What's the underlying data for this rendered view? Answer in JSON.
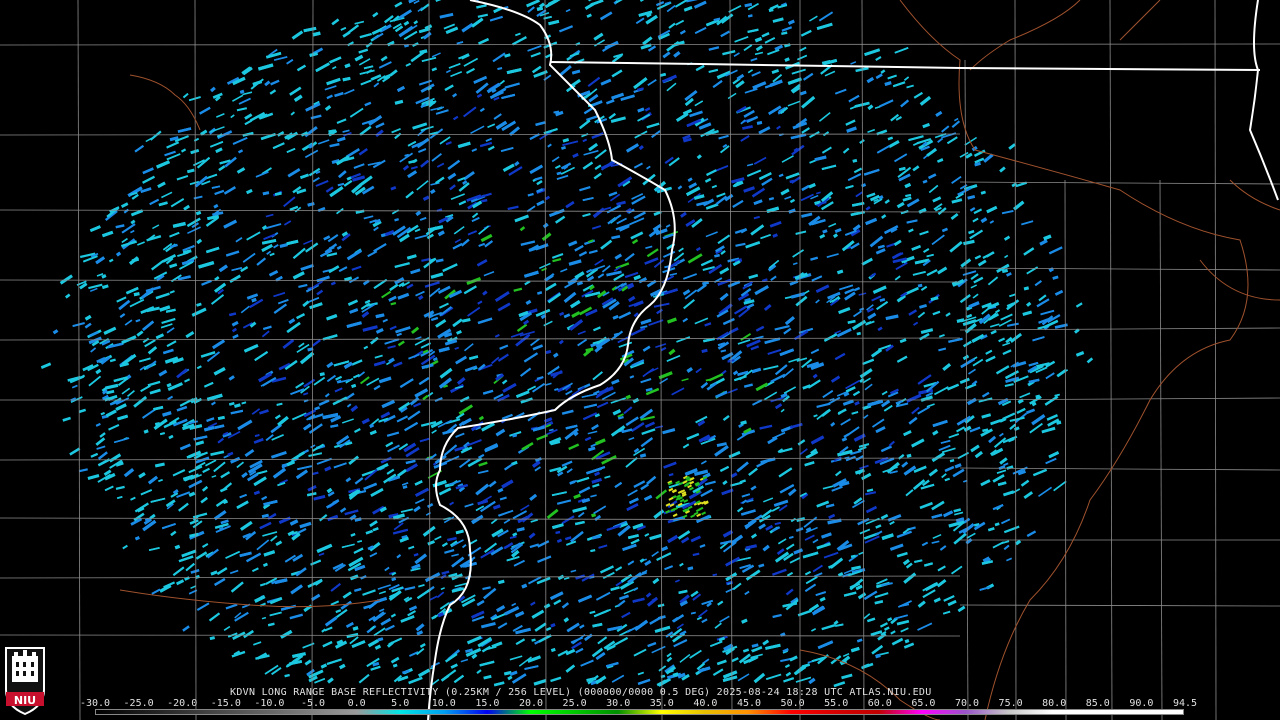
{
  "caption": "KDVN LONG RANGE BASE REFLECTIVITY (0.25KM / 256 LEVEL) (000000/0000 0.5 DEG) 2025-08-24 18:28 UTC  ATLAS.NIU.EDU",
  "logo_text": "NIU",
  "colorbar": {
    "labels": [
      "-30.0",
      "-25.0",
      "-20.0",
      "-15.0",
      "-10.0",
      "-5.0",
      "0.0",
      "5.0",
      "10.0",
      "15.0",
      "20.0",
      "25.0",
      "30.0",
      "35.0",
      "40.0",
      "45.0",
      "50.0",
      "55.0",
      "60.0",
      "65.0",
      "70.0",
      "75.0",
      "80.0",
      "85.0",
      "90.0",
      "94.5"
    ],
    "gradient_stops": [
      "#000000",
      "#1a1a1a",
      "#333333",
      "#4d4d4d",
      "#666666",
      "#808080",
      "#9a9a9a",
      "#00e5e5",
      "#00a0f0",
      "#0000f0",
      "#00ff00",
      "#00c800",
      "#009000",
      "#ffff00",
      "#e7c000",
      "#ff9000",
      "#ff0000",
      "#d60000",
      "#c00000",
      "#ff00ff",
      "#9955c9",
      "#c8c8c8",
      "#ffffff",
      "#ffffff",
      "#ffffff",
      "#ffffff"
    ]
  },
  "colors": {
    "state_border": "#ffffff",
    "county_border": "#8c8c8c",
    "river": "#a0522d",
    "echo_light": "#1cc8e0",
    "echo_mid": "#1a8ce8",
    "echo_dark": "#1038c8",
    "echo_green": "#22c020",
    "echo_yellow": "#e0e020"
  }
}
